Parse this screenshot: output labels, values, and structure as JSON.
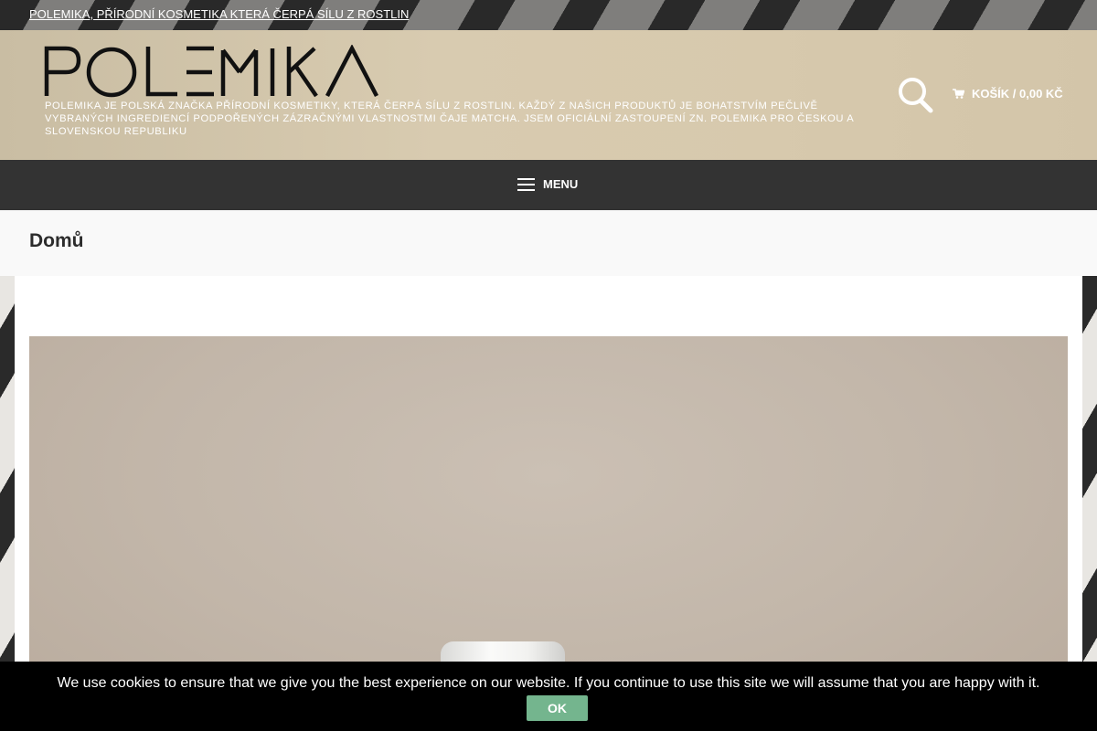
{
  "topbar": {
    "link_text": "POLEMIKA, PŘÍRODNÍ KOSMETIKA KTERÁ ČERPÁ SÍLU Z ROSTLIN"
  },
  "header": {
    "logo_text": "POLEMIKA",
    "tagline": "POLEMIKA JE POLSKÁ ZNAČKA PŘÍRODNÍ KOSMETIKY, KTERÁ ČERPÁ SÍLU Z ROSTLIN. KAŽDÝ Z NAŠICH PRODUKTŮ JE BOHATSTVÍM PEČLIVĚ VYBRANÝCH INGREDIENCÍ PODPOŘENÝCH ZÁZRAČNÝMI VLASTNOSTMI ČAJE MATCHA. JSEM OFICIÁLNÍ ZASTOUPENÍ ZN. POLEMIKA PRO ČESKOU A SLOVENSKOU REPUBLIKU",
    "search_icon": "search-icon",
    "cart_icon": "cart-icon",
    "cart_label": "KOŠÍK / 0,00 KČ"
  },
  "nav": {
    "menu_icon": "hamburger-icon",
    "menu_label": "MENU"
  },
  "page": {
    "title": "Domů"
  },
  "cookie": {
    "message": "We use cookies to ensure that we give you the best experience on our website. If you continue to use this site we will assume that you are happy with it.",
    "ok_label": "OK"
  },
  "colors": {
    "header_bg": "#d8cbb0",
    "nav_bg": "#333333",
    "cookie_bg": "#000000",
    "ok_button": "#74b58e"
  }
}
